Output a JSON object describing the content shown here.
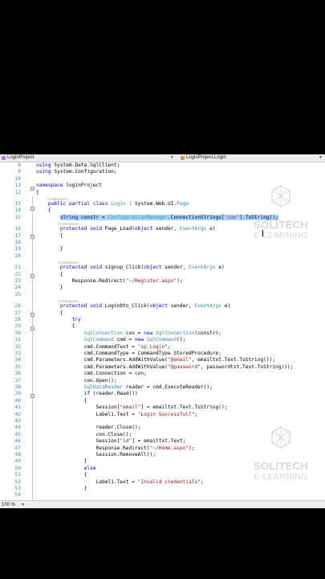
{
  "navigation": {
    "project_selector": "LoginProject",
    "member_selector": "LoginProject.Login"
  },
  "status": {
    "zoom": "100 %"
  },
  "watermark": {
    "brand": "SOLITECH",
    "tagline": "E-LEARNING"
  },
  "icons": {
    "project": "csharp-project-icon",
    "member": "class-icon",
    "dropdown": "chevron-down-icon"
  },
  "colors": {
    "keyword": "#0000ff",
    "type": "#2b91af",
    "string": "#a31515",
    "selection": "#add6ff"
  },
  "lines": [
    {
      "n": "8",
      "t": "using System.Data.SqlClient;"
    },
    {
      "n": "9",
      "t": "using System.Configuration;"
    },
    {
      "n": "10",
      "t": ""
    },
    {
      "n": "11",
      "t": "namespace loginProject"
    },
    {
      "n": "12",
      "t": "{"
    },
    {
      "ref": "2 references"
    },
    {
      "n": "13",
      "t": "    public partial class Login : System.Web.UI.Page"
    },
    {
      "n": "14",
      "t": "    {"
    },
    {
      "n": "15",
      "t": "        string constr = ConfigurationManager.ConnectionStrings[\"con\"].ToString();"
    },
    {
      "ref": "0 references"
    },
    {
      "n": "16",
      "t": "        protected void Page_Load(object sender, EventArgs e)"
    },
    {
      "n": "17",
      "t": "        {"
    },
    {
      "n": "18",
      "t": ""
    },
    {
      "n": "19",
      "t": "        }"
    },
    {
      "n": "20",
      "t": ""
    },
    {
      "ref": "0 references"
    },
    {
      "n": "21",
      "t": "        protected void signup_Click(object sender, EventArgs e)"
    },
    {
      "n": "22",
      "t": "        {"
    },
    {
      "n": "23",
      "t": "            Response.Redirect(\"~/Register.aspx\");"
    },
    {
      "n": "24",
      "t": "        }"
    },
    {
      "n": "25",
      "t": ""
    },
    {
      "ref": "0 references"
    },
    {
      "n": "26",
      "t": "        protected void Loginbtn_Click(object sender, EventArgs e)"
    },
    {
      "n": "27",
      "t": "        {"
    },
    {
      "n": "28",
      "t": "            try"
    },
    {
      "n": "29",
      "t": "            {"
    },
    {
      "n": "30",
      "t": "                SqlConnection con = new SqlConnection(constr);"
    },
    {
      "n": "31",
      "t": "                SqlCommand cmd = new SqlCommand();"
    },
    {
      "n": "32",
      "t": "                cmd.CommandText = \"sp_Login\";"
    },
    {
      "n": "33",
      "t": "                cmd.CommandType = CommandType.StoredProcedure;"
    },
    {
      "n": "34",
      "t": "                cmd.Parameters.AddWithValue(\"@email\", emailtxt.Text.ToString());"
    },
    {
      "n": "35",
      "t": "                cmd.Parameters.AddWithValue(\"@password\", passwordtxt.Text.ToString());"
    },
    {
      "n": "36",
      "t": "                cmd.Connection = con;"
    },
    {
      "n": "37",
      "t": "                con.Open();"
    },
    {
      "n": "38",
      "t": "                SqlDataReader reader = cmd.ExecuteReader();"
    },
    {
      "n": "39",
      "t": "                if (reader.Read())"
    },
    {
      "n": "40",
      "t": "                {"
    },
    {
      "n": "41",
      "t": "                    Session[\"email\"] = emailtxt.Text.ToString();"
    },
    {
      "n": "42",
      "t": "                    Label1.Text = \"Login Successfull\";"
    },
    {
      "n": "43",
      "t": ""
    },
    {
      "n": "44",
      "t": "                    reader.Close();"
    },
    {
      "n": "45",
      "t": "                    con.Close();"
    },
    {
      "n": "46",
      "t": "                    Session[\"id\"] = emailtxt.Text;"
    },
    {
      "n": "47",
      "t": "                    Response.Redirect(\"~/Home.aspx\");"
    },
    {
      "n": "48",
      "t": "                    Session.RemoveAll();"
    },
    {
      "n": "49",
      "t": "                }"
    },
    {
      "n": "50",
      "t": "                else"
    },
    {
      "n": "51",
      "t": "                {"
    },
    {
      "n": "52",
      "t": "                    Label1.Text = \"Invalid credentials\";"
    },
    {
      "n": "53",
      "t": "                }"
    },
    {
      "n": "54",
      "t": ""
    }
  ]
}
